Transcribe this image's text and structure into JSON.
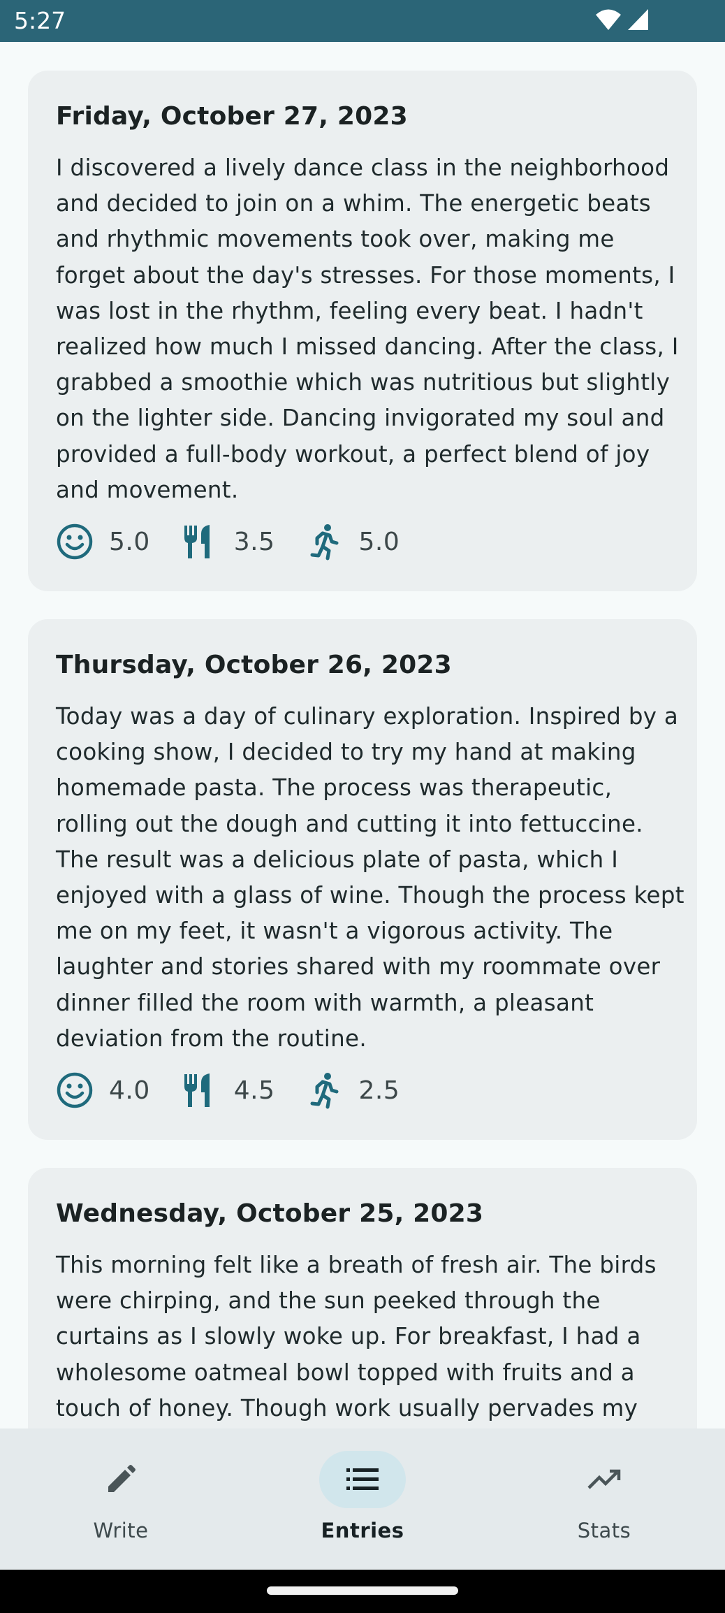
{
  "status_bar": {
    "time": "5:27",
    "icons": [
      "wifi-icon",
      "signal-icon"
    ]
  },
  "entries": [
    {
      "date": "Friday, October 27, 2023",
      "text": "I discovered a lively dance class in the neighborhood and decided to join on a whim. The energetic beats and rhythmic movements took over, making me forget about the day's stresses. For those moments, I was lost in the rhythm, feeling every beat. I hadn't realized how much I missed dancing. After the class, I grabbed a smoothie which was nutritious but slightly on the lighter side. Dancing invigorated my soul and provided a full-body workout, a perfect blend of joy and movement.",
      "mood": "5.0",
      "food": "3.5",
      "activity": "5.0"
    },
    {
      "date": "Thursday, October 26, 2023",
      "text": "Today was a day of culinary exploration. Inspired by a cooking show, I decided to try my hand at making homemade pasta. The process was therapeutic, rolling out the dough and cutting it into fettuccine. The result was a delicious plate of pasta, which I enjoyed with a glass of wine. Though the process kept me on my feet, it wasn't a vigorous activity. The laughter and stories shared with my roommate over dinner filled the room with warmth, a pleasant deviation from the routine.",
      "mood": "4.0",
      "food": "4.5",
      "activity": "2.5"
    },
    {
      "date": "Wednesday, October 25, 2023",
      "text": "This morning felt like a breath of fresh air. The birds were chirping, and the sun peeked through the curtains as I slowly woke up. For breakfast, I had a wholesome oatmeal bowl topped with fruits and a touch of honey. Though work usually pervades my"
    }
  ],
  "metric_icons": {
    "mood": "smiley-icon",
    "food": "fork-knife-icon",
    "activity": "running-icon"
  },
  "bottom_nav": {
    "write": "Write",
    "entries": "Entries",
    "stats": "Stats",
    "selected": "Entries"
  },
  "colors": {
    "status_bar": "#2b6577",
    "accent": "#1f6a7c",
    "card_background": "#ebeff0",
    "page_background": "#f6fafa",
    "nav_background": "#e4eaec",
    "nav_indicator": "#d1e6ec"
  }
}
